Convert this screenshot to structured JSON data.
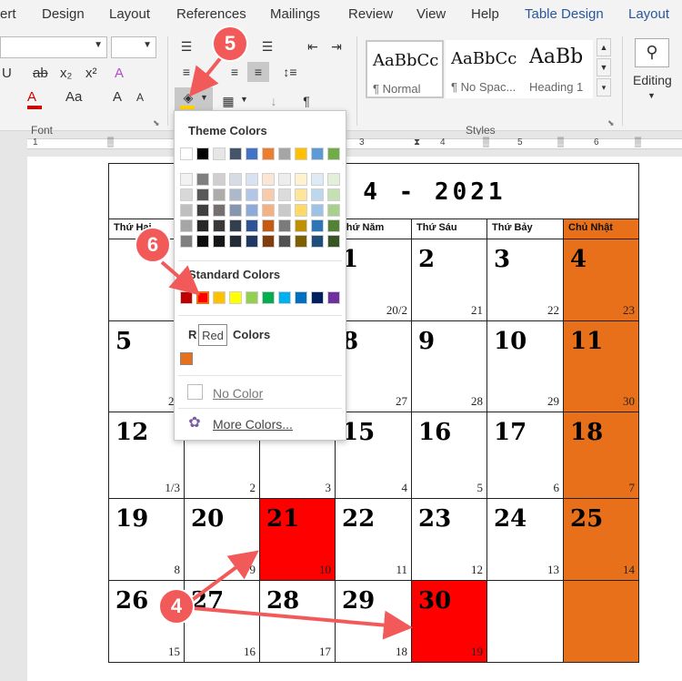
{
  "ribbon_tabs": [
    "ert",
    "Design",
    "Layout",
    "References",
    "Mailings",
    "Review",
    "View",
    "Help",
    "Table Design",
    "Layout"
  ],
  "ribbon": {
    "font_group": "Font",
    "styles_group": "Styles",
    "editing_label": "Editing",
    "styles": [
      {
        "sample": "AaBbCc",
        "name": "¶ Normal"
      },
      {
        "sample": "AaBbCc",
        "name": "¶ No Spac..."
      },
      {
        "sample": "AaBb",
        "name": "Heading 1"
      }
    ],
    "x2_label": "x₂",
    "x2sup_label": "x²",
    "aa_label": "Aa",
    "a_label": "A",
    "ab_label": "ab"
  },
  "ruler_numbers": [
    "1",
    "1",
    "2",
    "3",
    "4",
    "5",
    "6"
  ],
  "colors": {
    "red": "#ff0000",
    "orange": "#e8701a",
    "accent": "#2b579a",
    "badge": "#f25a5a"
  },
  "popup": {
    "theme_title": "Theme Colors",
    "standard_title": "Standard Colors",
    "recent_title": "Recent Colors",
    "recent_left": "R",
    "recent_right": "Colors",
    "no_color": "No Color",
    "more_colors": "More Colors...",
    "tooltip": "Red",
    "theme_top": [
      "#ffffff",
      "#000000",
      "#e7e6e6",
      "#44546a",
      "#4472c4",
      "#ed7d31",
      "#a5a5a5",
      "#ffc000",
      "#5b9bd5",
      "#70ad47"
    ],
    "theme_shades": [
      [
        "#f2f2f2",
        "#7f7f7f",
        "#d0cece",
        "#d6dce4",
        "#d9e2f3",
        "#fbe5d5",
        "#ededed",
        "#fff2cc",
        "#deeaf6",
        "#e2efd9"
      ],
      [
        "#d8d8d8",
        "#595959",
        "#aeabab",
        "#adb9ca",
        "#b4c6e7",
        "#f7cbac",
        "#dbdbdb",
        "#fee599",
        "#bdd7ee",
        "#c5e0b3"
      ],
      [
        "#bfbfbf",
        "#3f3f3f",
        "#757070",
        "#8496b0",
        "#8eaadb",
        "#f4b183",
        "#c9c9c9",
        "#ffd965",
        "#9cc3e5",
        "#a8d08d"
      ],
      [
        "#a5a5a5",
        "#262626",
        "#3a3838",
        "#323f4f",
        "#2f5496",
        "#c55a11",
        "#7b7b7b",
        "#bf9000",
        "#2e75b5",
        "#538135"
      ],
      [
        "#7f7f7f",
        "#0c0c0c",
        "#171616",
        "#222a35",
        "#1f3864",
        "#833c0b",
        "#525252",
        "#7f6000",
        "#1e4e79",
        "#375623"
      ]
    ],
    "standard": [
      "#c00000",
      "#ff0000",
      "#ffc000",
      "#ffff00",
      "#92d050",
      "#00b050",
      "#00b0f0",
      "#0070c0",
      "#002060",
      "#7030a0"
    ],
    "recent": [
      "#e8701a"
    ]
  },
  "calendar": {
    "title": "G 4 - 2021",
    "headers": [
      "Thứ Hai",
      "",
      "",
      "Thứ Năm",
      "Thứ Sáu",
      "Thứ Bảy",
      "Chủ Nhật"
    ],
    "weeks": [
      {
        "days": [
          {
            "d": "",
            "l": ""
          },
          {
            "d": "",
            "l": ""
          },
          {
            "d": "",
            "l": ""
          },
          {
            "d": "1",
            "l": "20/2"
          },
          {
            "d": "2",
            "l": "21"
          },
          {
            "d": "3",
            "l": "22"
          },
          {
            "d": "4",
            "l": "23"
          }
        ]
      },
      {
        "days": [
          {
            "d": "5",
            "l": "24"
          },
          {
            "d": "",
            "l": ""
          },
          {
            "d": "",
            "l": ""
          },
          {
            "d": "8",
            "l": "27"
          },
          {
            "d": "9",
            "l": "28"
          },
          {
            "d": "10",
            "l": "29"
          },
          {
            "d": "11",
            "l": "30"
          }
        ]
      },
      {
        "days": [
          {
            "d": "12",
            "l": "1/3"
          },
          {
            "d": "",
            "l": "2"
          },
          {
            "d": "",
            "l": "3"
          },
          {
            "d": "15",
            "l": "4"
          },
          {
            "d": "16",
            "l": "5"
          },
          {
            "d": "17",
            "l": "6"
          },
          {
            "d": "18",
            "l": "7"
          }
        ]
      },
      {
        "days": [
          {
            "d": "19",
            "l": "8"
          },
          {
            "d": "20",
            "l": "9"
          },
          {
            "d": "21",
            "l": "10"
          },
          {
            "d": "22",
            "l": "11"
          },
          {
            "d": "23",
            "l": "12"
          },
          {
            "d": "24",
            "l": "13"
          },
          {
            "d": "25",
            "l": "14"
          }
        ]
      },
      {
        "days": [
          {
            "d": "26",
            "l": "15"
          },
          {
            "d": "27",
            "l": "16"
          },
          {
            "d": "28",
            "l": "17"
          },
          {
            "d": "29",
            "l": "18"
          },
          {
            "d": "30",
            "l": "19"
          },
          {
            "d": "",
            "l": ""
          },
          {
            "d": "",
            "l": ""
          }
        ]
      }
    ]
  },
  "badges": [
    "5",
    "6",
    "4"
  ]
}
